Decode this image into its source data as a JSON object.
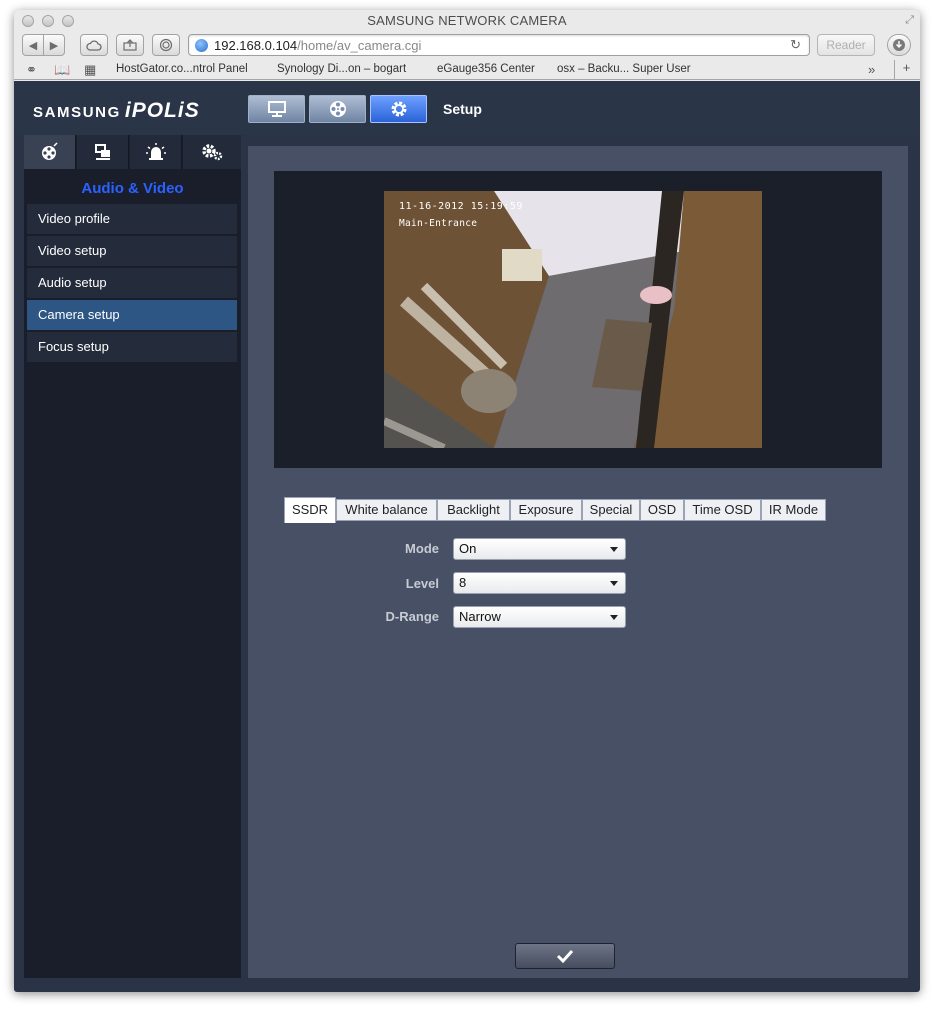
{
  "browser": {
    "window_title": "SAMSUNG NETWORK CAMERA",
    "url_host": "192.168.0.104",
    "url_path": "/home/av_camera.cgi",
    "reader_label": "Reader",
    "bookmarks": [
      {
        "label": "HostGator.co...ntrol Panel"
      },
      {
        "label": "Synology Di...on – bogart"
      },
      {
        "label": "eGauge356 Center"
      },
      {
        "label": "osx – Backu... Super User"
      }
    ]
  },
  "app": {
    "brand": "SAMSUNG",
    "product": "iPOLiS",
    "mode_buttons": [
      {
        "icon": "monitor-icon"
      },
      {
        "icon": "film-reel-icon"
      },
      {
        "icon": "gear-icon",
        "active": true
      }
    ],
    "page_title": "Setup",
    "side_tabs": [
      {
        "icon": "film-reel-icon",
        "active": true
      },
      {
        "icon": "network-icon"
      },
      {
        "icon": "alarm-icon"
      },
      {
        "icon": "gears-icon"
      }
    ],
    "section_title": "Audio & Video",
    "menu": [
      {
        "label": "Video profile"
      },
      {
        "label": "Video setup"
      },
      {
        "label": "Audio setup"
      },
      {
        "label": "Camera setup",
        "active": true
      },
      {
        "label": "Focus setup"
      }
    ],
    "video": {
      "osd_date": "11-16-2012 15:19:59",
      "osd_name": "Main-Entrance"
    },
    "tabs": [
      {
        "label": "SSDR",
        "active": true
      },
      {
        "label": "White balance"
      },
      {
        "label": "Backlight"
      },
      {
        "label": "Exposure"
      },
      {
        "label": "Special"
      },
      {
        "label": "OSD"
      },
      {
        "label": "Time OSD"
      },
      {
        "label": "IR Mode"
      }
    ],
    "fields": [
      {
        "label": "Mode",
        "value": "On"
      },
      {
        "label": "Level",
        "value": "8"
      },
      {
        "label": "D-Range",
        "value": "Narrow"
      }
    ],
    "apply_icon": "checkmark-icon",
    "colors": {
      "accent_blue": "#2b62ff",
      "active_menu": "#2d5684",
      "content_bg": "#475064",
      "sidebar_bg": "#191e2a"
    }
  }
}
